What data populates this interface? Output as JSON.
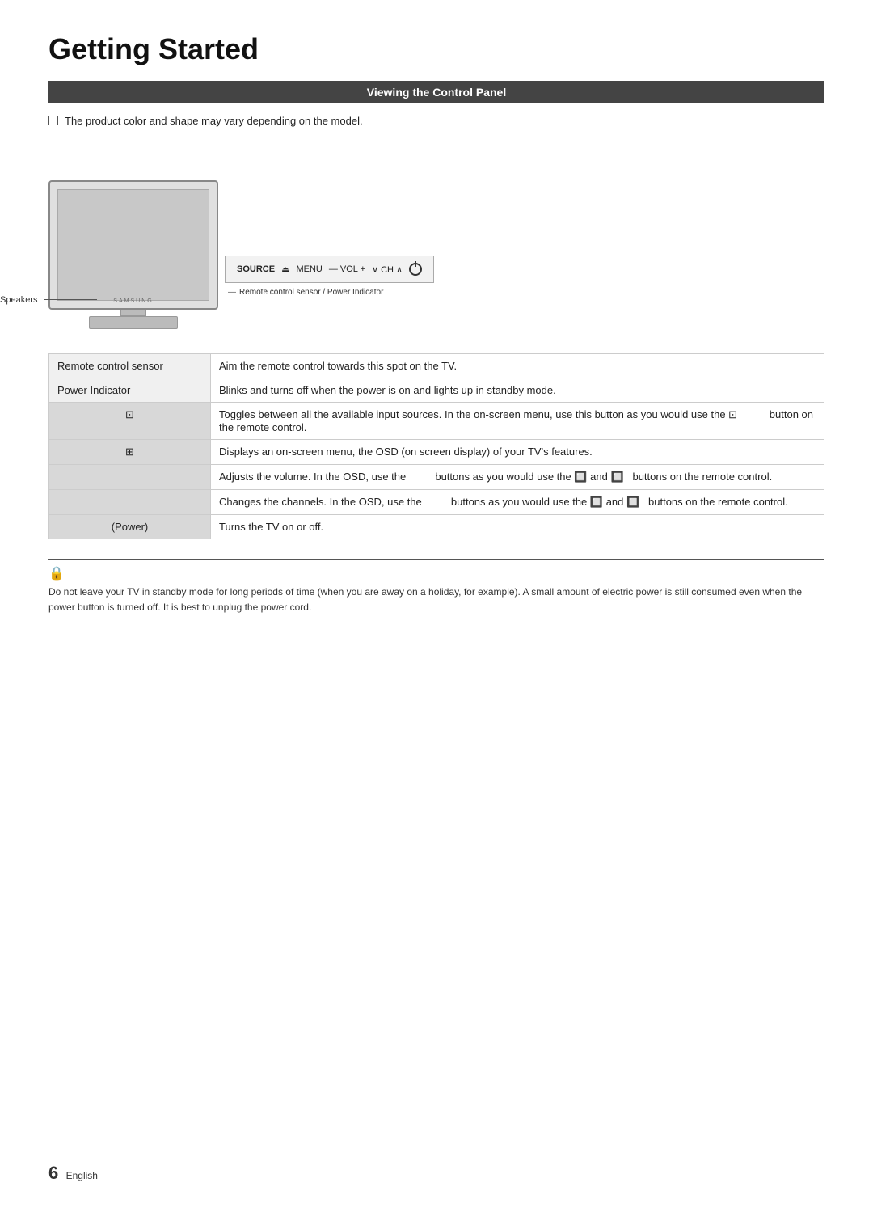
{
  "page": {
    "title": "Getting Started",
    "section_header": "Viewing the Control Panel",
    "note_checkbox_text": "The product color and shape may vary depending on the model.",
    "tv_brand": "SAMSUNG",
    "controls": {
      "source_label": "SOURCE",
      "source_icon": "⏏",
      "menu_label": "MENU",
      "vol_label": "— VOL +",
      "ch_label": "∨ CH ∧"
    },
    "sensor_annotation": "Remote control sensor / Power Indicator",
    "speakers_label": "Speakers",
    "table": {
      "rows": [
        {
          "label": "Remote control sensor",
          "icon": "",
          "description": "Aim the remote control towards this spot on the TV."
        },
        {
          "label": "Power Indicator",
          "icon": "",
          "description": "Blinks and turns off when the power is on and lights up in standby mode."
        },
        {
          "label": "🔲",
          "icon": "⊡",
          "description": "Toggles between all the available input sources. In the on-screen menu, use this button as you would use the 🔲   button on the remote control."
        },
        {
          "label": "🔲",
          "icon": "⊞",
          "description": "Displays an on-screen menu, the OSD (on screen display) of your TV's features."
        },
        {
          "label": "",
          "icon": "",
          "description": "Adjusts the volume. In the OSD, use the           buttons as you would use the 🔲 and 🔲  buttons on the remote control."
        },
        {
          "label": "",
          "icon": "",
          "description": "Changes the channels. In the OSD, use the           buttons as you would use the 🔲 and 🔲  buttons on the remote control."
        },
        {
          "label": "(Power)",
          "icon": "⏻",
          "description": "Turns the TV on or off."
        }
      ]
    },
    "note": {
      "icon": "🔒",
      "text": "Do not leave your TV in standby mode for long periods of time (when you are away on a holiday, for example). A small amount of electric power is still consumed even when the power button is turned off. It is best to unplug the power cord."
    },
    "footer": {
      "page_number": "6",
      "language": "English"
    }
  }
}
